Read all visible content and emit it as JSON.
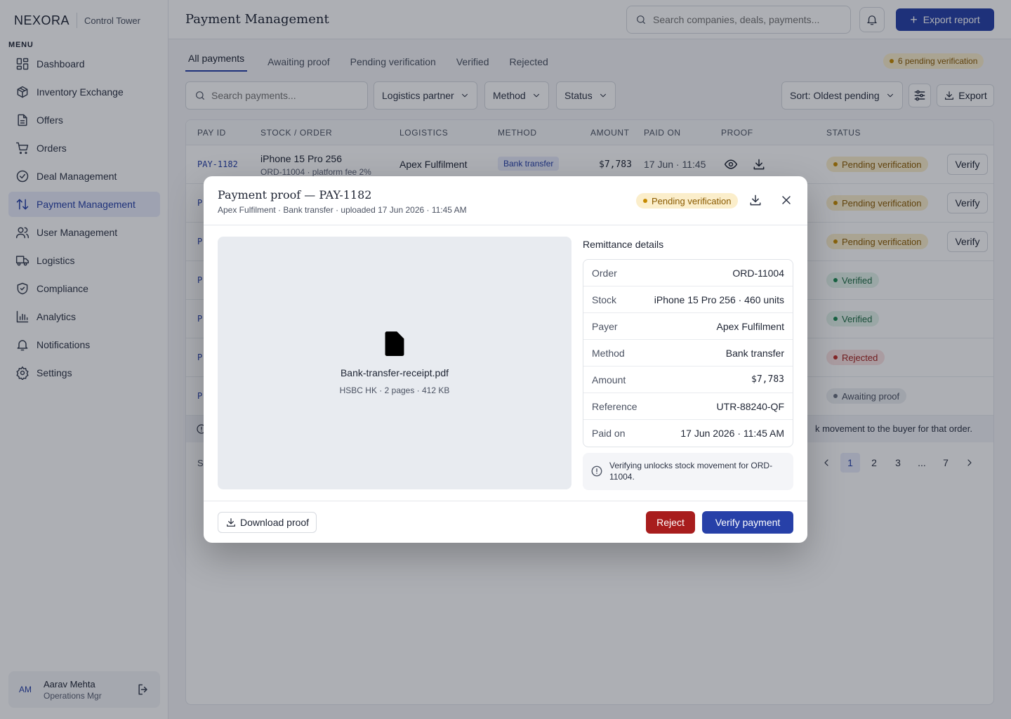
{
  "brand": {
    "logo": "NEXORA",
    "subtitle": "Control Tower"
  },
  "sidebar": {
    "menu_label": "MENU",
    "items": [
      {
        "label": "Dashboard",
        "icon": "grid-icon"
      },
      {
        "label": "Inventory Exchange",
        "icon": "box-icon"
      },
      {
        "label": "Offers",
        "icon": "document-icon"
      },
      {
        "label": "Orders",
        "icon": "cart-icon"
      },
      {
        "label": "Deal Management",
        "icon": "check-circle-icon"
      },
      {
        "label": "Payment Management",
        "icon": "transfer-arrows-icon",
        "active": true
      },
      {
        "label": "User Management",
        "icon": "users-icon"
      },
      {
        "label": "Logistics",
        "icon": "truck-icon"
      },
      {
        "label": "Compliance",
        "icon": "shield-check-icon"
      },
      {
        "label": "Analytics",
        "icon": "bar-chart-icon"
      },
      {
        "label": "Notifications",
        "icon": "bell-icon"
      },
      {
        "label": "Settings",
        "icon": "gear-icon"
      }
    ],
    "user": {
      "initials": "AM",
      "name": "Aarav Mehta",
      "role": "Operations Mgr"
    }
  },
  "header": {
    "title": "Payment Management",
    "search_placeholder": "Search companies, deals, payments...",
    "export_label": "Export report"
  },
  "tabs": [
    "All payments",
    "Awaiting proof",
    "Pending verification",
    "Verified",
    "Rejected"
  ],
  "pending_chip": "6 pending verification",
  "filters": {
    "search_placeholder": "Search payments...",
    "logistics": "Logistics partner",
    "method": "Method",
    "status": "Status",
    "sort": "Sort: Oldest pending",
    "export": "Export"
  },
  "table": {
    "columns": [
      "PAY ID",
      "STOCK / ORDER",
      "LOGISTICS",
      "METHOD",
      "AMOUNT",
      "PAID ON",
      "PROOF",
      "STATUS"
    ],
    "rows": [
      {
        "pay_id": "PAY-1182",
        "stock": "iPhone 15 Pro 256",
        "order": "ORD-11004 · platform fee 2%",
        "logistics": "Apex Fulfilment",
        "method": "Bank transfer",
        "amount": "$7,783",
        "paid_on": "17 Jun · 11:45",
        "status": "Pending verification",
        "action": "Verify"
      },
      {
        "pay_id": "P",
        "status": "Pending verification",
        "action": "Verify"
      },
      {
        "pay_id": "P",
        "status": "Pending verification",
        "action": "Verify"
      },
      {
        "pay_id": "P",
        "status": "Verified"
      },
      {
        "pay_id": "P",
        "status": "Verified"
      },
      {
        "pay_id": "P",
        "status": "Rejected"
      },
      {
        "pay_id": "P",
        "status": "Awaiting proof"
      }
    ],
    "banner": "k movement to the buyer for that order.",
    "footer_left": "S",
    "pages": [
      "1",
      "2",
      "3",
      "...",
      "7"
    ]
  },
  "modal": {
    "title": "Payment proof — PAY-1182",
    "subtitle": "Apex Fulfilment · Bank transfer · uploaded 17 Jun 2026 · 11:45 AM",
    "status": "Pending verification",
    "file": {
      "name": "Bank-transfer-receipt.pdf",
      "meta": "HSBC HK · 2 pages · 412 KB"
    },
    "remittance_title": "Remittance details",
    "remittance": [
      {
        "k": "Order",
        "v": "ORD-11004"
      },
      {
        "k": "Stock",
        "v": "iPhone 15 Pro 256 · 460 units"
      },
      {
        "k": "Payer",
        "v": "Apex Fulfilment"
      },
      {
        "k": "Method",
        "v": "Bank transfer"
      },
      {
        "k": "Amount",
        "v": "$7,783"
      },
      {
        "k": "Reference",
        "v": "UTR-88240-QF"
      },
      {
        "k": "Paid on",
        "v": "17 Jun 2026 · 11:45 AM"
      }
    ],
    "info": "Verifying unlocks stock movement for ORD-11004.",
    "download_label": "Download proof",
    "reject_label": "Reject",
    "verify_label": "Verify payment"
  },
  "colors": {
    "accent": "#2740a8",
    "danger": "#a81d1d",
    "pending": "#fbeecb",
    "verified": "#e3f3ea",
    "rejected": "#fbe3e3"
  }
}
